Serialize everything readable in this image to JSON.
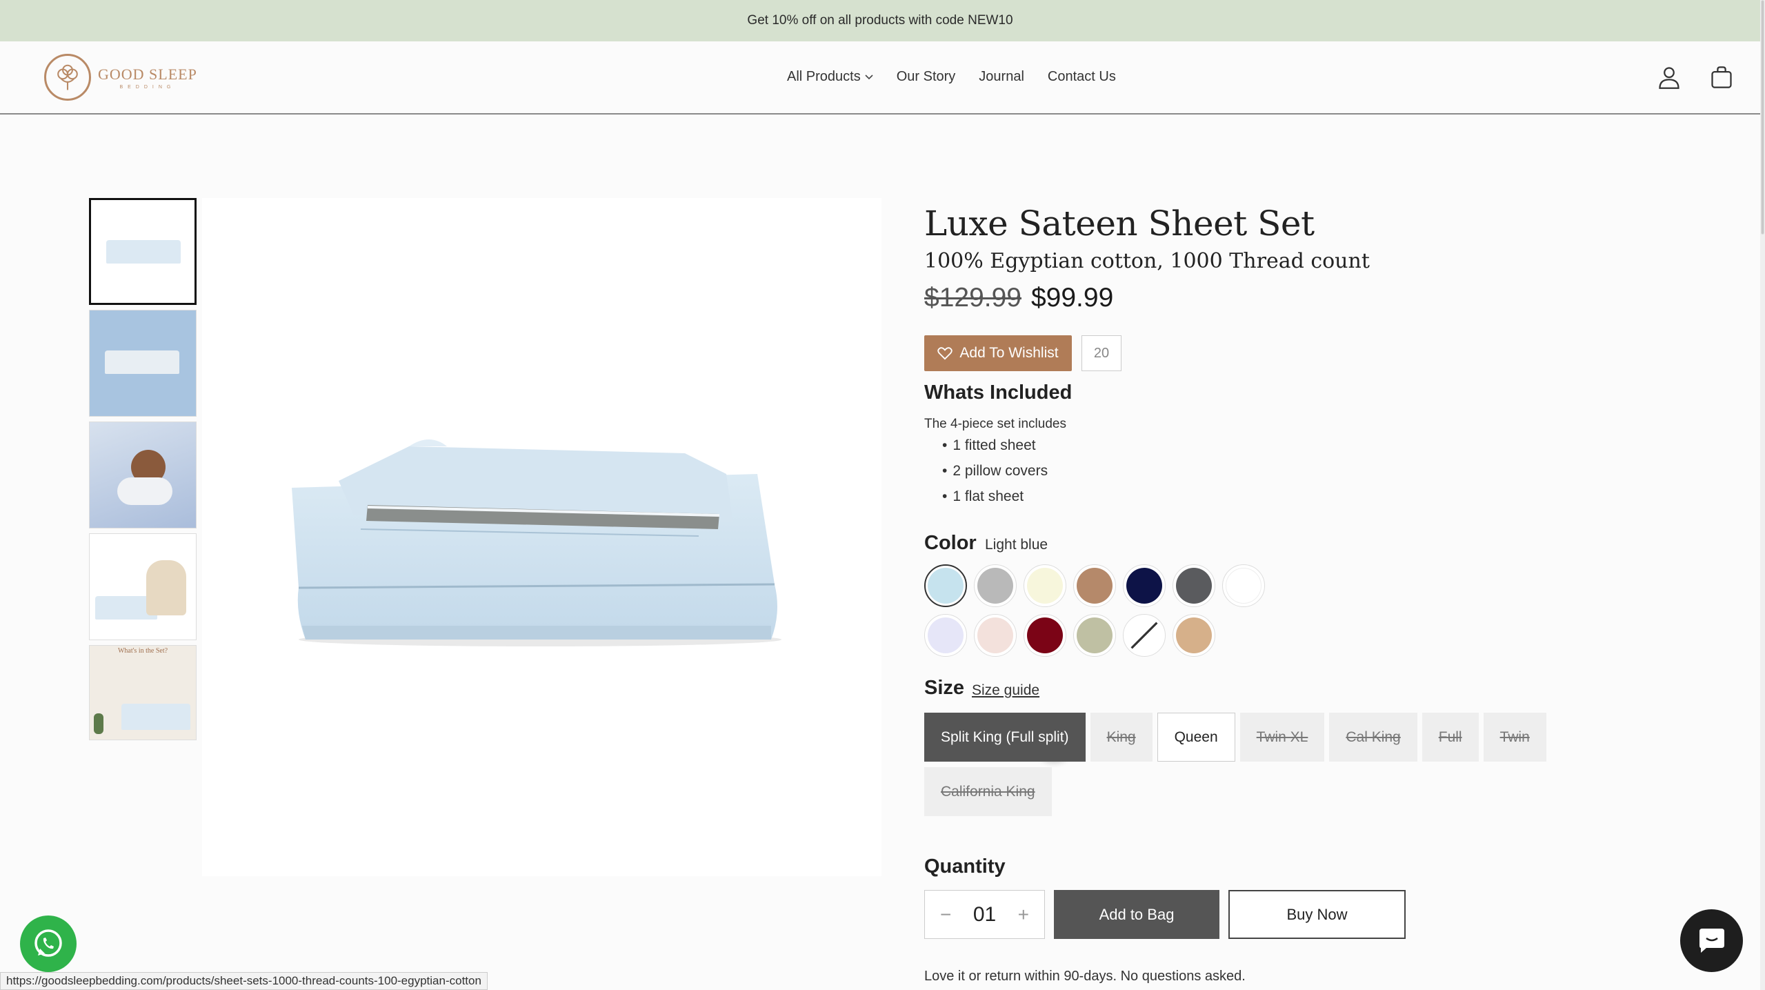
{
  "announcement": "Get 10% off on all products with code NEW10",
  "brand": {
    "name": "GOOD SLEEP",
    "tagline": "BEDDING"
  },
  "nav": {
    "all_products": "All Products",
    "our_story": "Our Story",
    "journal": "Journal",
    "contact": "Contact Us"
  },
  "product": {
    "title": "Luxe Sateen Sheet Set",
    "subtitle": "100% Egyptian cotton, 1000 Thread count",
    "old_price": "$129.99",
    "price": "$99.99",
    "wishlist_label": "Add To Wishlist",
    "wishlist_count": "20",
    "included_heading": "Whats Included",
    "included_intro": "The 4-piece set includes",
    "included_items": [
      "1 fitted sheet",
      "2 pillow covers",
      "1 flat sheet"
    ],
    "color_heading": "Color",
    "color_value": "Light blue",
    "colors": [
      "#c6e3ee",
      "#b9b9b9",
      "#f7f6dc",
      "#b5896a",
      "#0d1347",
      "#5a5b5e",
      "#ffffff",
      "#e6e6f8",
      "#f3e1dc",
      "#7b0416",
      "#bfc0a3",
      "crossed",
      "#d6b08a"
    ],
    "size_heading": "Size",
    "size_guide": "Size guide",
    "sizes": [
      {
        "label": "Split King (Full split)",
        "state": "selected"
      },
      {
        "label": "King",
        "state": "unavailable"
      },
      {
        "label": "Queen",
        "state": "available"
      },
      {
        "label": "Twin XL",
        "state": "unavailable"
      },
      {
        "label": "Cal King",
        "state": "unavailable"
      },
      {
        "label": "Full",
        "state": "unavailable"
      },
      {
        "label": "Twin",
        "state": "unavailable"
      },
      {
        "label": "California King",
        "state": "unavailable"
      }
    ],
    "quantity_heading": "Quantity",
    "quantity": "01",
    "add_to_bag": "Add to Bag",
    "buy_now": "Buy Now",
    "returns": "Love it or return within 90-days. No questions asked."
  },
  "thumbnail_info_caption": "What's in the Set?",
  "status_url": "https://goodsleepbedding.com/products/sheet-sets-1000-thread-counts-100-egyptian-cotton",
  "colors": {
    "announcement_bg": "#d6e1cf",
    "wishlist": "#b07c57",
    "whatsapp": "#2fb34a"
  }
}
